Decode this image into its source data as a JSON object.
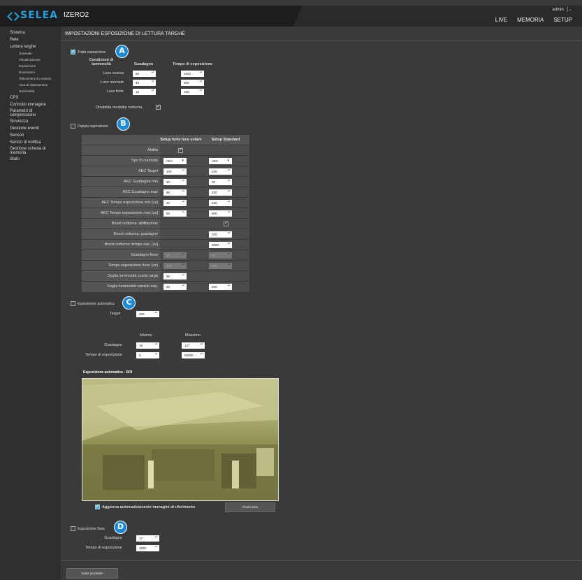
{
  "header": {
    "brand": "SELEA",
    "device": "IZERO2",
    "user": "admin",
    "logout_glyph": "[→",
    "nav": [
      "LIVE",
      "MEMORIA",
      "SETUP"
    ]
  },
  "sidebar": {
    "items": [
      {
        "label": "Sistema",
        "level": 0
      },
      {
        "label": "Rete",
        "level": 0
      },
      {
        "label": "Lettura targhe",
        "level": 0
      },
      {
        "label": "Generale",
        "level": 1
      },
      {
        "label": "Visualizzazione",
        "level": 1
      },
      {
        "label": "Esposizione",
        "level": 1
      },
      {
        "label": "Illuminatore",
        "level": 1
      },
      {
        "label": "Telecamera di contesto",
        "level": 1
      },
      {
        "label": "Area di elaborazione",
        "level": 1
      },
      {
        "label": "Nazionalità",
        "level": 1
      },
      {
        "label": "CPS",
        "level": 0
      },
      {
        "label": "Controllo immagine",
        "level": 0
      },
      {
        "label": "Parametri di compressione",
        "level": 0
      },
      {
        "label": "Sicurezza",
        "level": 0
      },
      {
        "label": "Gestione eventi",
        "level": 0
      },
      {
        "label": "Sensori",
        "level": 0
      },
      {
        "label": "Servizi di notifica",
        "level": 0
      },
      {
        "label": "Gestione scheda di memoria",
        "level": 0
      },
      {
        "label": "Stato",
        "level": 0
      }
    ]
  },
  "page": {
    "title": "IMPOSTAZIONI ESPOSIZIONE DI LETTURA TARGHE"
  },
  "markers": [
    "A",
    "B",
    "C",
    "D"
  ],
  "triple": {
    "label": "Tripla esposizione",
    "checked": true,
    "col_conditions": "Condizioni di luminosità",
    "col_gain": "Guadagno",
    "col_exposure": "Tempo di esposizione",
    "rows": [
      {
        "label": "Luce scarsa",
        "gain": "55",
        "exposure": "1000"
      },
      {
        "label": "Luce normale",
        "gain": "46",
        "exposure": "300"
      },
      {
        "label": "Luce forte",
        "gain": "16",
        "exposure": "100"
      }
    ],
    "night_label": "Disabilita modalità notturna",
    "night_checked": true
  },
  "double": {
    "label": "Doppia esposizione",
    "checked": false,
    "col_sun": "Setup forte luce solare",
    "col_std": "Setup Standard",
    "rows": [
      {
        "label": "Abilita",
        "sun": "check",
        "std": ""
      },
      {
        "label": "Tipo di controllo",
        "sun": "AEC",
        "std": "AEC",
        "kind": "select"
      },
      {
        "label": "AEC Target",
        "sun": "160",
        "std": "225"
      },
      {
        "label": "AEC Guadagno min",
        "sun": "20",
        "std": "35"
      },
      {
        "label": "AEC Guadagno max",
        "sun": "90",
        "std": "230"
      },
      {
        "label": "AEC Tempo esposizione min [us]",
        "sun": "30",
        "std": "130"
      },
      {
        "label": "AEC Tempo esposizione max [us]",
        "sun": "50",
        "std": "900"
      },
      {
        "label": "Boost notturna: abilitazione",
        "sun": "",
        "std": "check"
      },
      {
        "label": "Boost notturna: guadagno",
        "sun": "",
        "std": "320"
      },
      {
        "label": "Boost notturna: tempo exp. [us]",
        "sun": "",
        "std": "2000"
      },
      {
        "label": "Guadagno fisso",
        "sun": "16",
        "std": "40",
        "dim": true
      },
      {
        "label": "Tempo esposizione fisso (us)",
        "sun": "100",
        "std": "800",
        "dim": true
      },
      {
        "label": "Soglia luminosità scarto targa",
        "sun": "90",
        "std": ""
      },
      {
        "label": "Soglia luminosità cambio exp.",
        "sun": "48",
        "std": "250"
      }
    ]
  },
  "auto": {
    "label": "Esposizione automatica",
    "checked": false,
    "target_label": "Target",
    "target": "200",
    "col_min": "Minimo",
    "col_max": "Massimo",
    "rows": [
      {
        "label": "Guadagno",
        "min": "16",
        "max": "127"
      },
      {
        "label": "Tempo di esposizione",
        "min": "0",
        "max": "50000"
      }
    ],
    "roi_title": "Esposizione automatica - ROI",
    "update_label": "Aggiorna automaticamente immagini di riferimento",
    "update_checked": true,
    "reset_label": "Reset area"
  },
  "fixed": {
    "label": "Esposizione fissa",
    "checked": false,
    "rows": [
      {
        "label": "Guadagno",
        "value": "17"
      },
      {
        "label": "Tempo di esposizione",
        "value": "1000"
      }
    ]
  },
  "save_label": "Salva parametri",
  "colors": {
    "accent": "#25a0dc",
    "marker": "#1a8ad8",
    "roi_tint": "#c8c87a"
  }
}
